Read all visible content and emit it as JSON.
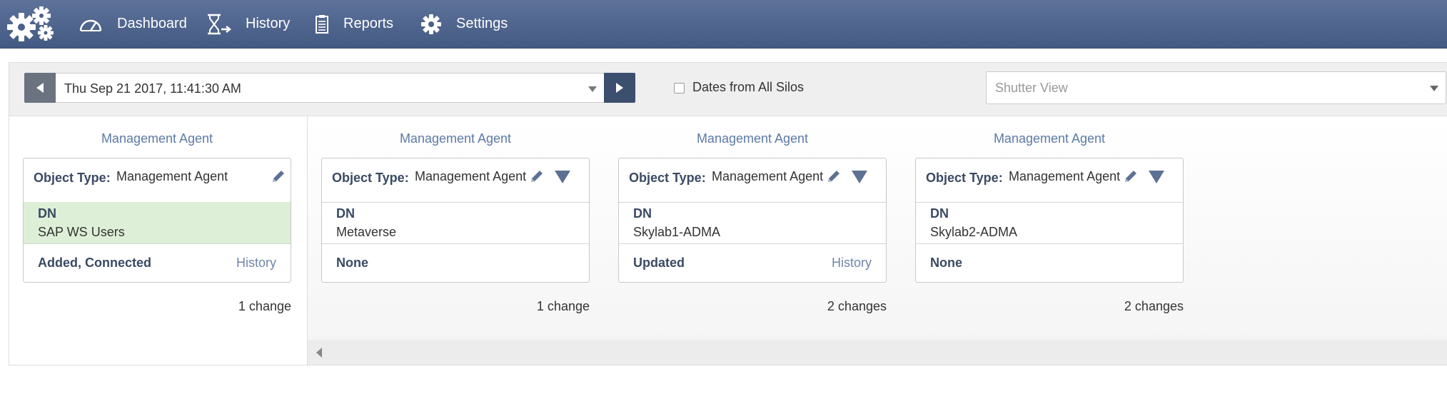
{
  "nav": {
    "items": [
      {
        "label": "Dashboard",
        "icon": "gauge-icon"
      },
      {
        "label": "History",
        "icon": "hourglass-icon"
      },
      {
        "label": "Reports",
        "icon": "clipboard-icon"
      },
      {
        "label": "Settings",
        "icon": "gear-icon"
      }
    ]
  },
  "toolbar": {
    "date_value": "Thu Sep 21 2017, 11:41:30 AM",
    "dates_all_silos_label": "Dates from All Silos",
    "dates_all_silos_checked": false,
    "view_placeholder": "Shutter View"
  },
  "columns": [
    {
      "title": "Management Agent",
      "object_type_label": "Object Type:",
      "object_type_value": "Management Agent",
      "dn_label": "DN",
      "dn_value": "SAP WS Users",
      "status": "Added, Connected",
      "history_link": "History",
      "changes": "1 change",
      "highlighted": true
    },
    {
      "title": "Management Agent",
      "object_type_label": "Object Type:",
      "object_type_value": "Management Agent",
      "dn_label": "DN",
      "dn_value": "Metaverse",
      "status": "None",
      "history_link": "",
      "changes": "1 change",
      "highlighted": false
    },
    {
      "title": "Management Agent",
      "object_type_label": "Object Type:",
      "object_type_value": "Management Agent",
      "dn_label": "DN",
      "dn_value": "Skylab1-ADMA",
      "status": "Updated",
      "history_link": "History",
      "changes": "2 changes",
      "highlighted": false
    },
    {
      "title": "Management Agent",
      "object_type_label": "Object Type:",
      "object_type_value": "Management Agent",
      "dn_label": "DN",
      "dn_value": "Skylab2-ADMA",
      "status": "None",
      "history_link": "",
      "changes": "2 changes",
      "highlighted": false
    }
  ],
  "colors": {
    "nav_bg": "#4f6590",
    "accent_text": "#5c7aa6",
    "connected_bg": "#deefd7"
  }
}
